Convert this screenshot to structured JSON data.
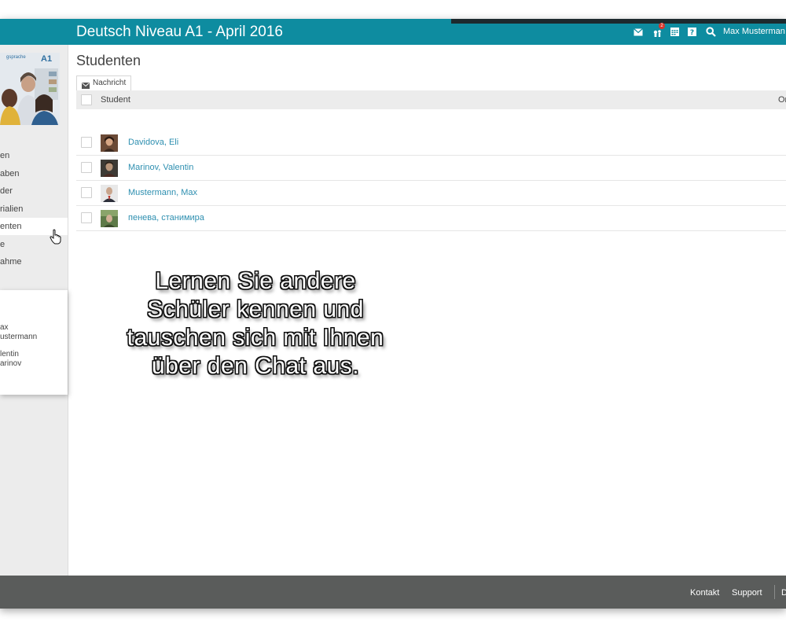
{
  "header": {
    "course_title": "Deutsch Niveau A1 - April 2016",
    "notification_count": "2",
    "user_name": "Max Musterman",
    "accent_color": "#0e8ca0"
  },
  "sidebar": {
    "cover_badge": "A1",
    "cover_text": "gsprache",
    "items": [
      {
        "label": "en"
      },
      {
        "label": "aben"
      },
      {
        "label": "der"
      },
      {
        "label": "rialien"
      },
      {
        "label": "enten"
      },
      {
        "label": "e"
      },
      {
        "label": "ahme"
      }
    ],
    "online_users": [
      {
        "line1": "ax",
        "line2": "ustermann"
      },
      {
        "line1": "lentin",
        "line2": "arinov"
      }
    ]
  },
  "main": {
    "page_title": "Studenten",
    "message_button": "Nachricht",
    "column_student": "Student",
    "column_right": "Or",
    "students": [
      {
        "name": "Davidova, Eli"
      },
      {
        "name": "Marinov, Valentin"
      },
      {
        "name": "Mustermann, Max"
      },
      {
        "name": "пенева, станимира"
      }
    ]
  },
  "overlay": {
    "line1": "Lernen Sie  andere",
    "line2": "Schüler kennen und",
    "line3": "tauschen sich mit Ihnen",
    "line4": "über den Chat aus."
  },
  "footer": {
    "links": [
      {
        "label": "Kontakt"
      },
      {
        "label": "Support"
      },
      {
        "label": "D"
      }
    ]
  }
}
